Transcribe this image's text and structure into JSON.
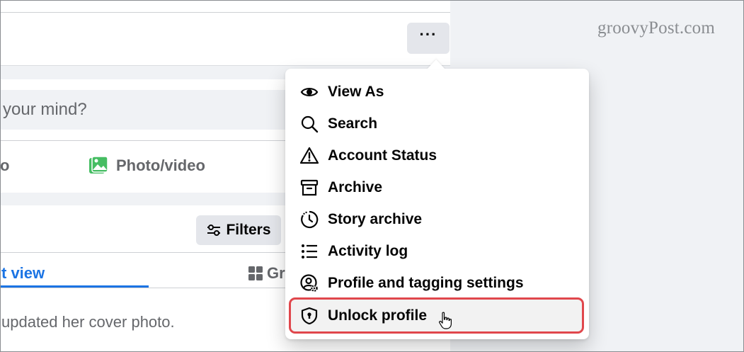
{
  "watermark": "groovyPost.com",
  "header": {
    "more_label": "···"
  },
  "composer": {
    "placeholder_fragment": "your mind?",
    "action_left_fragment": "o",
    "action_photo": "Photo/video"
  },
  "posts": {
    "filters_label": "Filters",
    "tab_list_fragment": "t view",
    "tab_grid_fragment": "Gri",
    "post_snippet": "updated her cover photo."
  },
  "menu": {
    "items": [
      {
        "label": "View As",
        "icon": "eye-icon"
      },
      {
        "label": "Search",
        "icon": "search-icon"
      },
      {
        "label": "Account Status",
        "icon": "warning-icon"
      },
      {
        "label": "Archive",
        "icon": "archive-box-icon"
      },
      {
        "label": "Story archive",
        "icon": "clock-history-icon"
      },
      {
        "label": "Activity log",
        "icon": "list-icon"
      },
      {
        "label": "Profile and tagging settings",
        "icon": "user-gear-icon"
      },
      {
        "label": "Unlock profile",
        "icon": "shield-lock-icon"
      }
    ]
  },
  "colors": {
    "accent_blue": "#1b74e4",
    "highlight_border": "#e0474c",
    "photo_green": "#45bd62"
  }
}
